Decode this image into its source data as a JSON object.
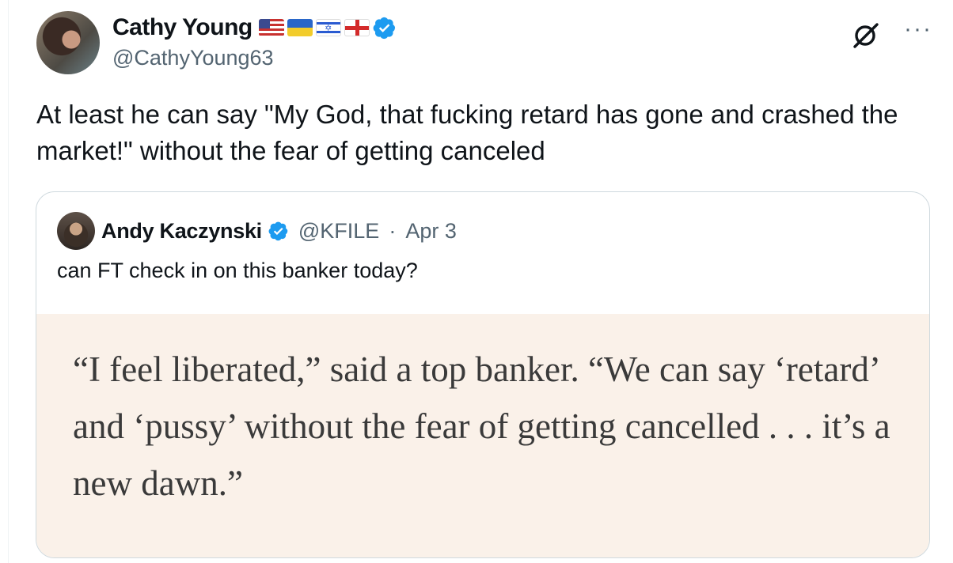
{
  "author": {
    "display_name": "Cathy Young",
    "handle": "@CathyYoung63",
    "flags": [
      "us-flag",
      "ukraine-flag",
      "israel-flag",
      "georgia-flag"
    ]
  },
  "tweet": {
    "text": "At least he can say \"My God, that fucking retard has gone and crashed the market!\" without the fear of getting canceled"
  },
  "quoted": {
    "display_name": "Andy Kaczynski",
    "handle": "@KFILE",
    "separator": "·",
    "date": "Apr 3",
    "text": "can FT check in on this banker today?",
    "media_text": "“I feel liberated,” said a top banker. “We can say ‘retard’ and ‘pussy’ without the fear of getting cancelled . . . it’s a new dawn.”"
  },
  "icons": {
    "verified": "verified-badge-icon",
    "grok": "grok-icon",
    "more": "more-icon"
  },
  "colors": {
    "verified_blue": "#1d9bf0",
    "secondary_text": "#536471",
    "media_bg": "#faf1e9"
  }
}
